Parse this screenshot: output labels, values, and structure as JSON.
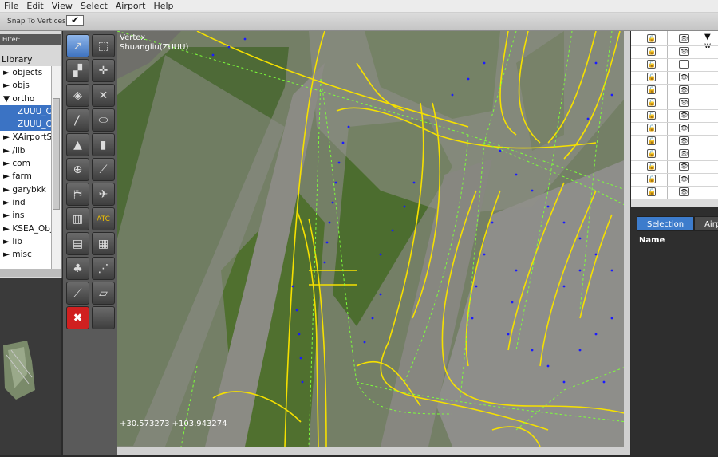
{
  "menu": {
    "items": [
      "File",
      "Edit",
      "View",
      "Select",
      "Airport",
      "Help"
    ]
  },
  "options": {
    "snap_label": "Snap To Vertices",
    "snap_checked": "✔"
  },
  "library": {
    "filter_label": "Filter:",
    "header": "Library",
    "items": [
      {
        "label": "► objects"
      },
      {
        "label": "► objs"
      },
      {
        "label": "▼ ortho"
      },
      {
        "label": "ZUUU_C",
        "selected": true
      },
      {
        "label": "ZUUU_C",
        "selected": true
      },
      {
        "label": "► XAirportS"
      },
      {
        "label": "► /lib"
      },
      {
        "label": "► com"
      },
      {
        "label": "► farm"
      },
      {
        "label": "► garybkk"
      },
      {
        "label": "► ind"
      },
      {
        "label": "► ins"
      },
      {
        "label": "► KSEA_Obj"
      },
      {
        "label": "► lib"
      },
      {
        "label": "► misc"
      }
    ]
  },
  "tools": [
    {
      "name": "vertex-tool-icon",
      "glyph": "↗",
      "active": true
    },
    {
      "name": "marquee-tool-icon",
      "glyph": "⬚"
    },
    {
      "name": "runway-tool-icon",
      "glyph": "▞"
    },
    {
      "name": "helipad-tool-icon",
      "glyph": "✛"
    },
    {
      "name": "sealane-tool-icon",
      "glyph": "◈"
    },
    {
      "name": "taxiway-tool-icon",
      "glyph": "✕"
    },
    {
      "name": "taxiroute-tool-icon",
      "glyph": "〳"
    },
    {
      "name": "boundary-tool-icon",
      "glyph": "⬭"
    },
    {
      "name": "light-tool-icon",
      "glyph": "▲"
    },
    {
      "name": "sign-tool-icon",
      "glyph": "▮"
    },
    {
      "name": "tower-tool-icon",
      "glyph": "⊕"
    },
    {
      "name": "windsock-tool-icon",
      "glyph": "⟋"
    },
    {
      "name": "startup-tool-icon",
      "glyph": "⛿"
    },
    {
      "name": "beacon-tool-icon",
      "glyph": "✈"
    },
    {
      "name": "facade-tool-icon",
      "glyph": "▥"
    },
    {
      "name": "atc-tool-icon",
      "glyph": "ATC"
    },
    {
      "name": "object-tool-icon",
      "glyph": "▤"
    },
    {
      "name": "string-tool-icon",
      "glyph": "▦"
    },
    {
      "name": "forest-tool-icon",
      "glyph": "♣"
    },
    {
      "name": "line-tool-icon",
      "glyph": "⋰"
    },
    {
      "name": "polygon-tool-icon",
      "glyph": "⟋"
    },
    {
      "name": "draped-tool-icon",
      "glyph": "▱"
    },
    {
      "name": "exclusion-tool-icon",
      "glyph": "✖"
    },
    {
      "name": "blank-tool-icon",
      "glyph": ""
    }
  ],
  "map": {
    "tool_name": "Vertex",
    "airport_name": "Shuangliu(ZUUU)",
    "coordinates": "+30.573273 +103.943274"
  },
  "layers": {
    "rows": [
      {
        "eye": true
      },
      {
        "eye": true
      },
      {
        "eye": false
      },
      {
        "eye": true
      },
      {
        "eye": true
      },
      {
        "eye": true
      },
      {
        "eye": true
      },
      {
        "eye": true
      },
      {
        "eye": true
      },
      {
        "eye": true
      },
      {
        "eye": true
      },
      {
        "eye": true
      },
      {
        "eye": true
      }
    ],
    "header_mark": "▼ w"
  },
  "right": {
    "tabs": [
      "Selection",
      "Airp"
    ],
    "name_header": "Name"
  },
  "colors": {
    "taxi_line": "#f5e000",
    "edge_light": "#1a1aff",
    "route_line": "#7dff3a"
  }
}
